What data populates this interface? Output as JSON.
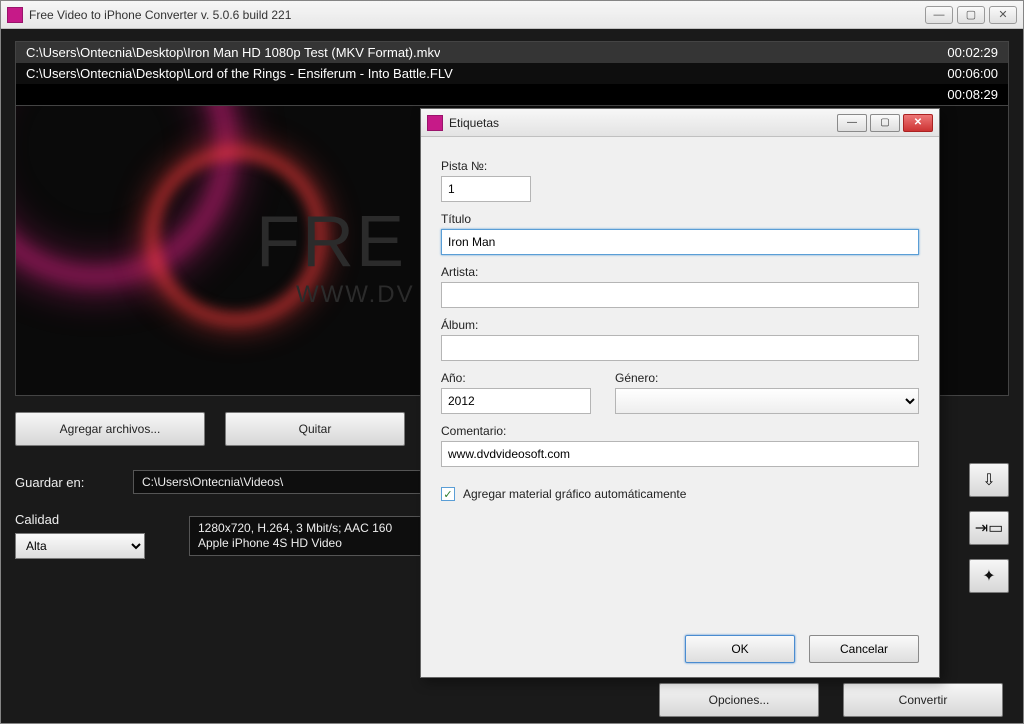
{
  "main_window": {
    "title": "Free Video to iPhone Converter  v. 5.0.6 build 221",
    "files": [
      {
        "path": "C:\\Users\\Ontecnia\\Desktop\\Iron Man HD 1080p Test (MKV Format).mkv",
        "duration": "00:02:29"
      },
      {
        "path": "C:\\Users\\Ontecnia\\Desktop\\Lord of the Rings - Ensiferum - Into Battle.FLV",
        "duration": "00:06:00"
      }
    ],
    "total_duration": "00:08:29",
    "preview_brand": "FRE",
    "preview_url": "WWW.DV",
    "buttons": {
      "add_files": "Agregar archivos...",
      "remove": "Quitar",
      "options": "Opciones...",
      "convert": "Convertir"
    },
    "save_in_label": "Guardar en:",
    "save_in_path": "C:\\Users\\Ontecnia\\Videos\\",
    "quality_label": "Calidad",
    "quality_value": "Alta",
    "quality_desc": "1280x720, H.264, 3 Mbit/s; AAC 160\nApple iPhone 4S HD Video"
  },
  "dialog": {
    "title": "Etiquetas",
    "labels": {
      "track": "Pista №:",
      "title": "Título",
      "artist": "Artista:",
      "album": "Álbum:",
      "year": "Año:",
      "genre": "Género:",
      "comment": "Comentario:",
      "add_artwork": "Agregar material gráfico automáticamente"
    },
    "values": {
      "track": "1",
      "title": "Iron Man",
      "artist": "",
      "album": "",
      "year": "2012",
      "genre": "",
      "comment": "www.dvdvideosoft.com",
      "add_artwork_checked": "✓"
    },
    "buttons": {
      "ok": "OK",
      "cancel": "Cancelar"
    }
  }
}
